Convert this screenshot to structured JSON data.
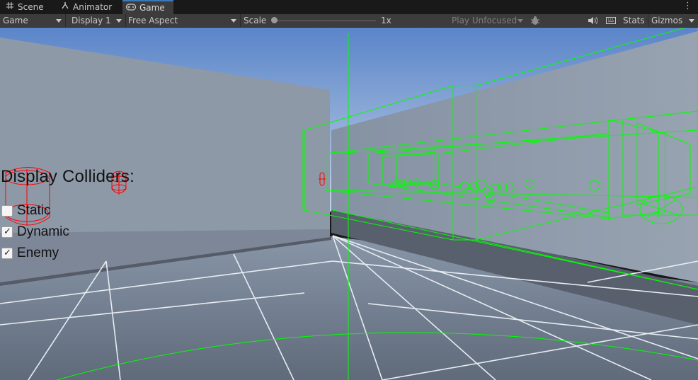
{
  "tabs": [
    {
      "label": "Scene",
      "icon": "grid-icon",
      "active": false
    },
    {
      "label": "Animator",
      "icon": "animator-icon",
      "active": false
    },
    {
      "label": "Game",
      "icon": "gamepad-icon",
      "active": true
    }
  ],
  "toolbar": {
    "view_mode": "Game",
    "display": "Display 1",
    "aspect": "Free Aspect",
    "scale_label": "Scale",
    "scale_value": "1x",
    "play_mode": "Play Unfocused",
    "stats": "Stats",
    "gizmos": "Gizmos"
  },
  "overlay": {
    "title": "Display Colliders:",
    "toggles": [
      {
        "label": "Static",
        "checked": false
      },
      {
        "label": "Dynamic",
        "checked": true
      },
      {
        "label": "Enemy",
        "checked": true
      }
    ]
  },
  "colors": {
    "sky_top": "#5a85c9",
    "sky_bottom": "#c3d2e6",
    "wall": "#8a97a8",
    "floor": "#6b7788",
    "gizmo_green": "#00ff00",
    "gizmo_red": "#ff0000"
  }
}
